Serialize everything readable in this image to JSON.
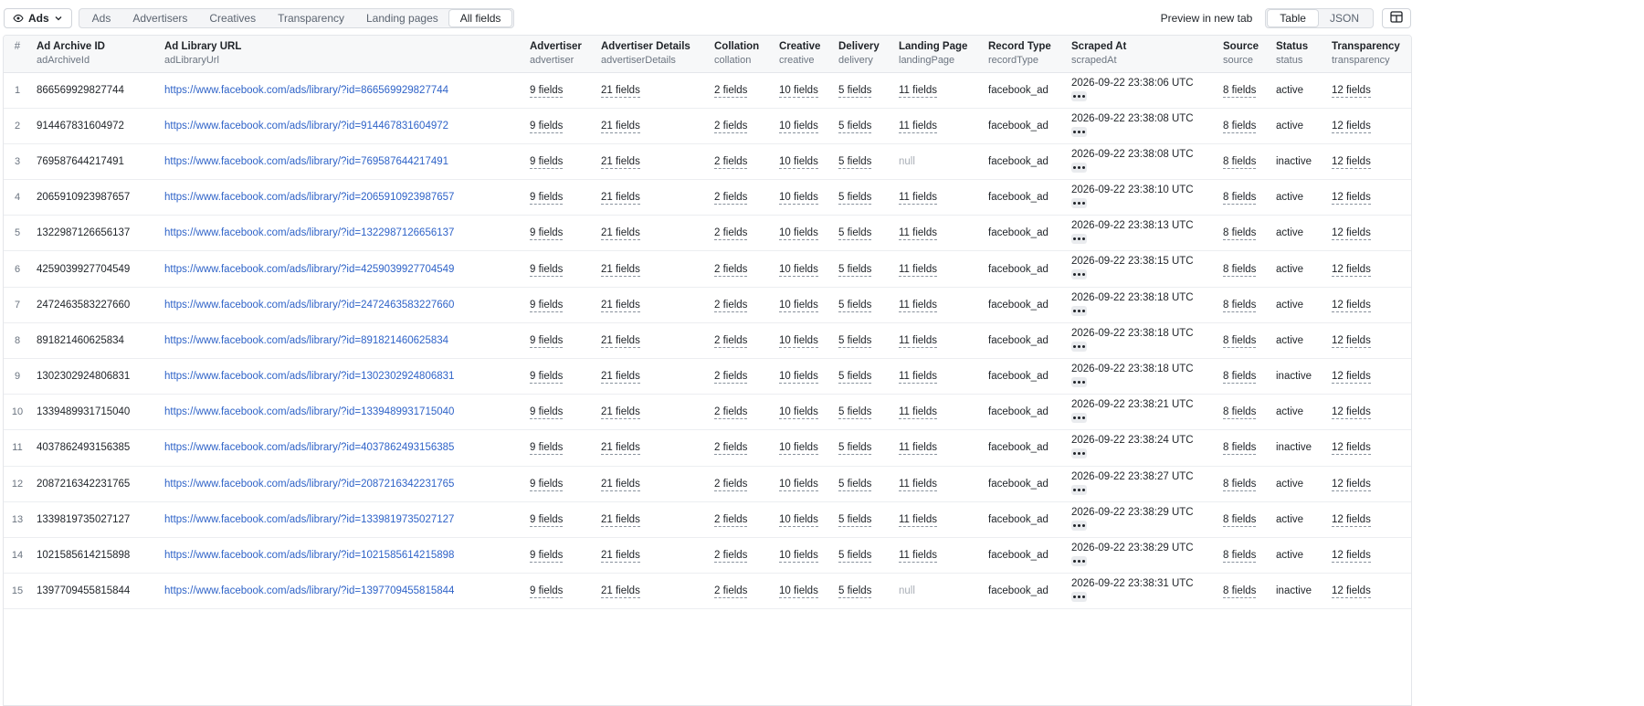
{
  "toolbar": {
    "dataset_label": "Ads",
    "view_tabs": [
      "Ads",
      "Advertisers",
      "Creatives",
      "Transparency",
      "Landing pages",
      "All fields"
    ],
    "active_view_tab": "All fields",
    "preview_label": "Preview in new tab",
    "modes": [
      "Table",
      "JSON"
    ],
    "active_mode": "Table"
  },
  "table": {
    "number_header": "#",
    "columns": [
      {
        "title": "Ad Archive ID",
        "key": "adArchiveId"
      },
      {
        "title": "Ad Library URL",
        "key": "adLibraryUrl"
      },
      {
        "title": "Advertiser",
        "key": "advertiser"
      },
      {
        "title": "Advertiser Details",
        "key": "advertiserDetails"
      },
      {
        "title": "Collation",
        "key": "collation"
      },
      {
        "title": "Creative",
        "key": "creative"
      },
      {
        "title": "Delivery",
        "key": "delivery"
      },
      {
        "title": "Landing Page",
        "key": "landingPage"
      },
      {
        "title": "Record Type",
        "key": "recordType"
      },
      {
        "title": "Scraped At",
        "key": "scrapedAt"
      },
      {
        "title": "Source",
        "key": "source"
      },
      {
        "title": "Status",
        "key": "status"
      },
      {
        "title": "Transparency",
        "key": "transparency"
      }
    ],
    "rows": [
      {
        "n": "1",
        "id": "866569929827744",
        "url": "https://www.facebook.com/ads/library/?id=866569929827744",
        "advertiser": "9 fields",
        "advertiserDetails": "21 fields",
        "collation": "2 fields",
        "creative": "10 fields",
        "delivery": "5 fields",
        "landingPage": "11 fields",
        "recordType": "facebook_ad",
        "scrapedAt": "2026-09-22 23:38:06 UTC",
        "source": "8 fields",
        "status": "active",
        "transparency": "12 fields"
      },
      {
        "n": "2",
        "id": "914467831604972",
        "url": "https://www.facebook.com/ads/library/?id=914467831604972",
        "advertiser": "9 fields",
        "advertiserDetails": "21 fields",
        "collation": "2 fields",
        "creative": "10 fields",
        "delivery": "5 fields",
        "landingPage": "11 fields",
        "recordType": "facebook_ad",
        "scrapedAt": "2026-09-22 23:38:08 UTC",
        "source": "8 fields",
        "status": "active",
        "transparency": "12 fields"
      },
      {
        "n": "3",
        "id": "769587644217491",
        "url": "https://www.facebook.com/ads/library/?id=769587644217491",
        "advertiser": "9 fields",
        "advertiserDetails": "21 fields",
        "collation": "2 fields",
        "creative": "10 fields",
        "delivery": "5 fields",
        "landingPage": "null",
        "recordType": "facebook_ad",
        "scrapedAt": "2026-09-22 23:38:08 UTC",
        "source": "8 fields",
        "status": "inactive",
        "transparency": "12 fields"
      },
      {
        "n": "4",
        "id": "2065910923987657",
        "url": "https://www.facebook.com/ads/library/?id=2065910923987657",
        "advertiser": "9 fields",
        "advertiserDetails": "21 fields",
        "collation": "2 fields",
        "creative": "10 fields",
        "delivery": "5 fields",
        "landingPage": "11 fields",
        "recordType": "facebook_ad",
        "scrapedAt": "2026-09-22 23:38:10 UTC",
        "source": "8 fields",
        "status": "active",
        "transparency": "12 fields"
      },
      {
        "n": "5",
        "id": "1322987126656137",
        "url": "https://www.facebook.com/ads/library/?id=1322987126656137",
        "advertiser": "9 fields",
        "advertiserDetails": "21 fields",
        "collation": "2 fields",
        "creative": "10 fields",
        "delivery": "5 fields",
        "landingPage": "11 fields",
        "recordType": "facebook_ad",
        "scrapedAt": "2026-09-22 23:38:13 UTC",
        "source": "8 fields",
        "status": "active",
        "transparency": "12 fields"
      },
      {
        "n": "6",
        "id": "4259039927704549",
        "url": "https://www.facebook.com/ads/library/?id=4259039927704549",
        "advertiser": "9 fields",
        "advertiserDetails": "21 fields",
        "collation": "2 fields",
        "creative": "10 fields",
        "delivery": "5 fields",
        "landingPage": "11 fields",
        "recordType": "facebook_ad",
        "scrapedAt": "2026-09-22 23:38:15 UTC",
        "source": "8 fields",
        "status": "active",
        "transparency": "12 fields"
      },
      {
        "n": "7",
        "id": "2472463583227660",
        "url": "https://www.facebook.com/ads/library/?id=2472463583227660",
        "advertiser": "9 fields",
        "advertiserDetails": "21 fields",
        "collation": "2 fields",
        "creative": "10 fields",
        "delivery": "5 fields",
        "landingPage": "11 fields",
        "recordType": "facebook_ad",
        "scrapedAt": "2026-09-22 23:38:18 UTC",
        "source": "8 fields",
        "status": "active",
        "transparency": "12 fields"
      },
      {
        "n": "8",
        "id": "891821460625834",
        "url": "https://www.facebook.com/ads/library/?id=891821460625834",
        "advertiser": "9 fields",
        "advertiserDetails": "21 fields",
        "collation": "2 fields",
        "creative": "10 fields",
        "delivery": "5 fields",
        "landingPage": "11 fields",
        "recordType": "facebook_ad",
        "scrapedAt": "2026-09-22 23:38:18 UTC",
        "source": "8 fields",
        "status": "active",
        "transparency": "12 fields"
      },
      {
        "n": "9",
        "id": "1302302924806831",
        "url": "https://www.facebook.com/ads/library/?id=1302302924806831",
        "advertiser": "9 fields",
        "advertiserDetails": "21 fields",
        "collation": "2 fields",
        "creative": "10 fields",
        "delivery": "5 fields",
        "landingPage": "11 fields",
        "recordType": "facebook_ad",
        "scrapedAt": "2026-09-22 23:38:18 UTC",
        "source": "8 fields",
        "status": "inactive",
        "transparency": "12 fields"
      },
      {
        "n": "10",
        "id": "1339489931715040",
        "url": "https://www.facebook.com/ads/library/?id=1339489931715040",
        "advertiser": "9 fields",
        "advertiserDetails": "21 fields",
        "collation": "2 fields",
        "creative": "10 fields",
        "delivery": "5 fields",
        "landingPage": "11 fields",
        "recordType": "facebook_ad",
        "scrapedAt": "2026-09-22 23:38:21 UTC",
        "source": "8 fields",
        "status": "active",
        "transparency": "12 fields"
      },
      {
        "n": "11",
        "id": "4037862493156385",
        "url": "https://www.facebook.com/ads/library/?id=4037862493156385",
        "advertiser": "9 fields",
        "advertiserDetails": "21 fields",
        "collation": "2 fields",
        "creative": "10 fields",
        "delivery": "5 fields",
        "landingPage": "11 fields",
        "recordType": "facebook_ad",
        "scrapedAt": "2026-09-22 23:38:24 UTC",
        "source": "8 fields",
        "status": "inactive",
        "transparency": "12 fields"
      },
      {
        "n": "12",
        "id": "2087216342231765",
        "url": "https://www.facebook.com/ads/library/?id=2087216342231765",
        "advertiser": "9 fields",
        "advertiserDetails": "21 fields",
        "collation": "2 fields",
        "creative": "10 fields",
        "delivery": "5 fields",
        "landingPage": "11 fields",
        "recordType": "facebook_ad",
        "scrapedAt": "2026-09-22 23:38:27 UTC",
        "source": "8 fields",
        "status": "active",
        "transparency": "12 fields"
      },
      {
        "n": "13",
        "id": "1339819735027127",
        "url": "https://www.facebook.com/ads/library/?id=1339819735027127",
        "advertiser": "9 fields",
        "advertiserDetails": "21 fields",
        "collation": "2 fields",
        "creative": "10 fields",
        "delivery": "5 fields",
        "landingPage": "11 fields",
        "recordType": "facebook_ad",
        "scrapedAt": "2026-09-22 23:38:29 UTC",
        "source": "8 fields",
        "status": "active",
        "transparency": "12 fields"
      },
      {
        "n": "14",
        "id": "1021585614215898",
        "url": "https://www.facebook.com/ads/library/?id=1021585614215898",
        "advertiser": "9 fields",
        "advertiserDetails": "21 fields",
        "collation": "2 fields",
        "creative": "10 fields",
        "delivery": "5 fields",
        "landingPage": "11 fields",
        "recordType": "facebook_ad",
        "scrapedAt": "2026-09-22 23:38:29 UTC",
        "source": "8 fields",
        "status": "active",
        "transparency": "12 fields"
      },
      {
        "n": "15",
        "id": "1397709455815844",
        "url": "https://www.facebook.com/ads/library/?id=1397709455815844",
        "advertiser": "9 fields",
        "advertiserDetails": "21 fields",
        "collation": "2 fields",
        "creative": "10 fields",
        "delivery": "5 fields",
        "landingPage": "null",
        "recordType": "facebook_ad",
        "scrapedAt": "2026-09-22 23:38:31 UTC",
        "source": "8 fields",
        "status": "inactive",
        "transparency": "12 fields"
      }
    ]
  }
}
